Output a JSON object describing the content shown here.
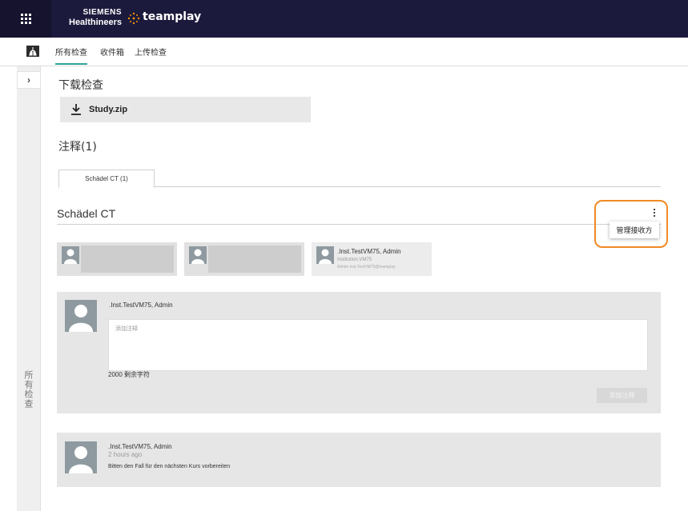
{
  "header": {
    "brand_line1": "SIEMENS",
    "brand_line2": "Healthineers",
    "product": "teamplay",
    "bg_color": "#1c1a3c"
  },
  "nav": {
    "tabs": [
      {
        "label": "所有检查",
        "active": true
      },
      {
        "label": "收件箱",
        "active": false
      },
      {
        "label": "上传检查",
        "active": false
      }
    ],
    "accent_color": "#2ea396"
  },
  "side": {
    "expand_icon": "chevron-right-icon",
    "vertical_label": "所有检查"
  },
  "download": {
    "title": "下载检查",
    "file_name": "Study.zip"
  },
  "annotations": {
    "title": "注释(1)",
    "tab_label": "Schädel CT (1)"
  },
  "group": {
    "title": "Schädel CT",
    "menu_item": "管理接收方",
    "highlight_color": "#f08a24"
  },
  "recipients": [
    {
      "name": "",
      "redacted": true
    },
    {
      "name": "",
      "redacted": true
    },
    {
      "name": ".Inst.TestVM75, Admin",
      "institution": "Institution.VM75",
      "email": "Admin Inst.TestVM75@teamplay",
      "redacted": false
    }
  ],
  "composer": {
    "user_name": ".Inst.TestVM75, Admin",
    "placeholder": "添加注释",
    "remaining": "2000 剩余字符",
    "add_button": "添加注释"
  },
  "comments": [
    {
      "user_name": ".Inst.TestVM75, Admin",
      "time": "2 hours ago",
      "text": "Bitten den Fall für den nächsten Kurs vorbereiten"
    }
  ]
}
